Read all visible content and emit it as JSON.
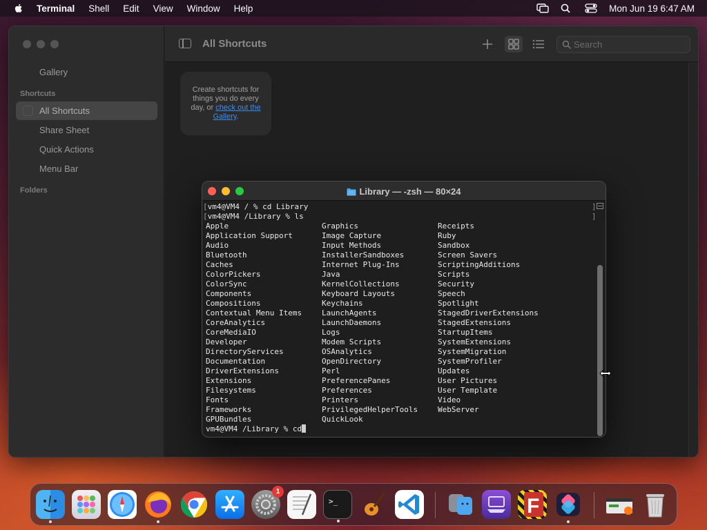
{
  "menubar": {
    "app_name": "Terminal",
    "menus": [
      "Shell",
      "Edit",
      "View",
      "Window",
      "Help"
    ],
    "clock": "Mon Jun 19  6:47 AM"
  },
  "shortcuts": {
    "title": "All Shortcuts",
    "gallery": "Gallery",
    "section_shortcuts": "Shortcuts",
    "items": [
      "All Shortcuts",
      "Share Sheet",
      "Quick Actions",
      "Menu Bar"
    ],
    "section_folders": "Folders",
    "search_placeholder": "Search",
    "empty_text": "Create shortcuts for things you do every day, or ",
    "empty_link": "check out the Gallery",
    "empty_end": "."
  },
  "terminal": {
    "title": "Library — -zsh — 80×24",
    "line1": "vm4@VM4 / % cd Library",
    "line2": "vm4@VM4 /Library % ls",
    "prompt": "vm4@VM4 /Library % cd",
    "col1": [
      "Apple",
      "Application Support",
      "Audio",
      "Bluetooth",
      "Caches",
      "ColorPickers",
      "ColorSync",
      "Components",
      "Compositions",
      "Contextual Menu Items",
      "CoreAnalytics",
      "CoreMediaIO",
      "Developer",
      "DirectoryServices",
      "Documentation",
      "DriverExtensions",
      "Extensions",
      "Filesystems",
      "Fonts",
      "Frameworks",
      "GPUBundles"
    ],
    "col2": [
      "Graphics",
      "Image Capture",
      "Input Methods",
      "InstallerSandboxes",
      "Internet Plug-Ins",
      "Java",
      "KernelCollections",
      "Keyboard Layouts",
      "Keychains",
      "LaunchAgents",
      "LaunchDaemons",
      "Logs",
      "Modem Scripts",
      "OSAnalytics",
      "OpenDirectory",
      "Perl",
      "PreferencePanes",
      "Preferences",
      "Printers",
      "PrivilegedHelperTools",
      "QuickLook"
    ],
    "col3": [
      "Receipts",
      "Ruby",
      "Sandbox",
      "Screen Savers",
      "ScriptingAdditions",
      "Scripts",
      "Security",
      "Speech",
      "Spotlight",
      "StagedDriverExtensions",
      "StagedExtensions",
      "StartupItems",
      "SystemExtensions",
      "SystemMigration",
      "SystemProfiler",
      "Updates",
      "User Pictures",
      "User Template",
      "Video",
      "WebServer"
    ]
  },
  "dock": {
    "settings_badge": "1",
    "apps": [
      "finder-icon",
      "launchpad-icon",
      "safari-icon",
      "firefox-icon",
      "chrome-icon",
      "app-store-icon",
      "system-settings-icon",
      "textedit-icon",
      "terminal-icon",
      "garageband-icon",
      "vscode-icon",
      "migration-assistant-icon",
      "apple-configurator-icon",
      "filezilla-icon",
      "shortcuts-icon",
      "downloads-stack-icon",
      "trash-icon"
    ]
  },
  "colors": {
    "close": "#ff5f57",
    "minimize": "#febc2e",
    "maximize": "#28c840",
    "link": "#3d8cf0"
  }
}
